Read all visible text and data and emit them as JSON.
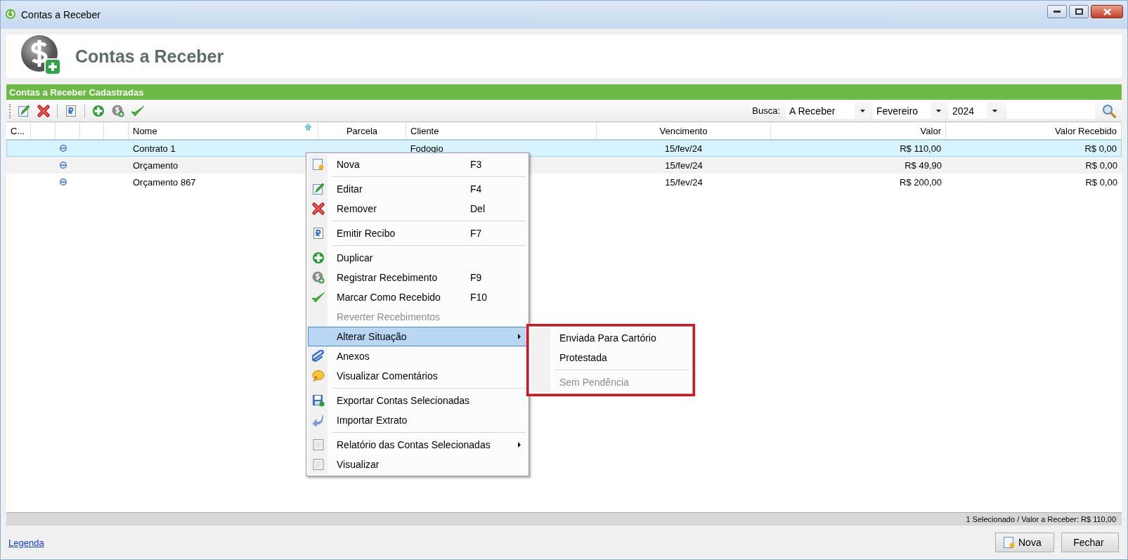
{
  "window": {
    "title": "Contas a Receber"
  },
  "header": {
    "title": "Contas a Receber"
  },
  "panel": {
    "title": "Contas a Receber Cadastradas"
  },
  "search": {
    "label": "Busca:",
    "filters": [
      {
        "value": "A Receber"
      },
      {
        "value": "Fevereiro"
      },
      {
        "value": "2024"
      }
    ]
  },
  "table": {
    "columns": [
      {
        "kind": "text",
        "label": "C..."
      },
      {
        "kind": "blank"
      },
      {
        "kind": "blank"
      },
      {
        "kind": "blank"
      },
      {
        "kind": "blank"
      },
      {
        "kind": "text",
        "label": "Nome",
        "sorted": true
      },
      {
        "kind": "text",
        "label": "Parcela"
      },
      {
        "kind": "text",
        "label": "Cliente"
      },
      {
        "kind": "text",
        "label": "Vencimento"
      },
      {
        "kind": "text",
        "label": "Valor"
      },
      {
        "kind": "text",
        "label": "Valor Recebido"
      }
    ],
    "rows": [
      {
        "selected": true,
        "nome": "Contrato 1",
        "cliente": "Fodogio",
        "vencimento": "15/fev/24",
        "valor": "R$ 110,00",
        "valor_recebido": "R$ 0,00"
      },
      {
        "selected": false,
        "nome": "Orçamento",
        "vencimento": "15/fev/24",
        "valor": "R$ 49,90",
        "valor_recebido": "R$ 0,00"
      },
      {
        "selected": false,
        "nome": "Orçamento 867",
        "vencimento": "15/fev/24",
        "valor": "R$ 200,00",
        "valor_recebido": "R$ 0,00"
      }
    ]
  },
  "context_menu": {
    "items": [
      {
        "kind": "item",
        "label": "Nova",
        "shortcut": "F3",
        "disabled": false,
        "selected": false
      },
      {
        "kind": "separator"
      },
      {
        "kind": "item",
        "label": "Editar",
        "shortcut": "F4",
        "disabled": false,
        "selected": false
      },
      {
        "kind": "item",
        "label": "Remover",
        "shortcut": "Del",
        "disabled": false,
        "selected": false
      },
      {
        "kind": "separator"
      },
      {
        "kind": "item",
        "label": "Emitir Recibo",
        "shortcut": "F7",
        "disabled": false,
        "selected": false
      },
      {
        "kind": "separator"
      },
      {
        "kind": "item",
        "label": "Duplicar",
        "disabled": false,
        "selected": false
      },
      {
        "kind": "item",
        "label": "Registrar Recebimento",
        "shortcut": "F9",
        "disabled": false,
        "selected": false
      },
      {
        "kind": "item",
        "label": "Marcar Como Recebido",
        "shortcut": "F10",
        "disabled": false,
        "selected": false
      },
      {
        "kind": "item",
        "label": "Reverter Recebimentos",
        "disabled": true,
        "selected": false
      },
      {
        "kind": "item",
        "label": "Alterar Situação",
        "disabled": false,
        "selected": true,
        "submenu": true
      },
      {
        "kind": "item",
        "label": "Anexos",
        "disabled": false,
        "selected": false
      },
      {
        "kind": "item",
        "label": "Visualizar Comentários",
        "disabled": false,
        "selected": false
      },
      {
        "kind": "separator"
      },
      {
        "kind": "item",
        "label": "Exportar Contas Selecionadas",
        "disabled": false,
        "selected": false
      },
      {
        "kind": "item",
        "label": "Importar Extrato",
        "disabled": false,
        "selected": false
      },
      {
        "kind": "separator"
      },
      {
        "kind": "item",
        "label": "Relatório das Contas Selecionadas",
        "disabled": false,
        "selected": false,
        "submenu": true
      },
      {
        "kind": "item",
        "label": "Visualizar",
        "disabled": false,
        "selected": false
      }
    ]
  },
  "submenu": {
    "framed": true,
    "items": [
      {
        "kind": "item",
        "label": "Enviada Para Cartório",
        "disabled": false,
        "selected": false
      },
      {
        "kind": "item",
        "label": "Protestada",
        "disabled": false,
        "selected": false
      },
      {
        "kind": "separator"
      },
      {
        "kind": "item",
        "label": "Sem Pendência",
        "disabled": true,
        "selected": false
      }
    ]
  },
  "status_bar": {
    "text": "1 Selecionado / Valor a Receber: R$ 110,00"
  },
  "footer": {
    "link": "Legenda",
    "buttons": [
      {
        "label": "Nova"
      },
      {
        "label": "Fechar"
      }
    ]
  }
}
